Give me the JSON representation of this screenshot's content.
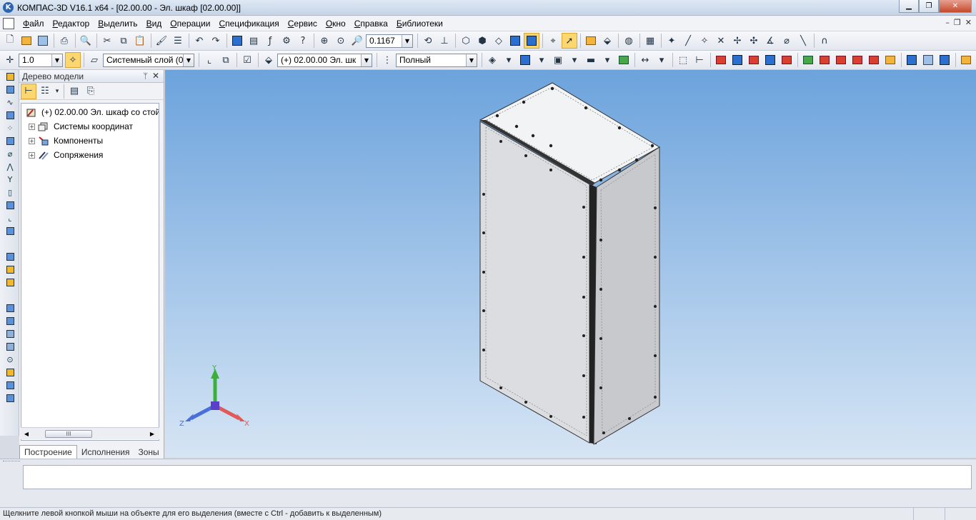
{
  "titlebar": {
    "title": "КОМПАС-3D V16.1 x64 - [02.00.00 - Эл. шкаф [02.00.00]]",
    "logo_letter": "K",
    "minimize": "▁",
    "maximize": "❐",
    "close": "✕"
  },
  "menu": [
    "Файл",
    "Редактор",
    "Выделить",
    "Вид",
    "Операции",
    "Спецификация",
    "Сервис",
    "Окно",
    "Справка",
    "Библиотеки"
  ],
  "mdi_controls": {
    "minimize": "–",
    "restore": "❐",
    "close": "✕"
  },
  "toolbar_top": {
    "zoom_value": "0.1167"
  },
  "toolbar_second": {
    "scale_value": "1.0",
    "layer_value": "Системный слой (0)",
    "object_value": "(+) 02.00.00 Эл. шк",
    "display_value": "Полный"
  },
  "tree": {
    "header": "Дерево модели",
    "pin": "ᛘ",
    "close": "✕",
    "root": "(+) 02.00.00 Эл. шкаф со стой",
    "children": [
      "Системы координат",
      "Компоненты",
      "Сопряжения"
    ],
    "scroll_thumb": "III",
    "tabs": [
      "Построение",
      "Исполнения",
      "Зоны"
    ]
  },
  "triad": {
    "y": "Y",
    "x": "X",
    "z": "Z"
  },
  "colors": {
    "viewport_top": "#6ca3dc",
    "viewport_bottom": "#d6e4f3",
    "highlight": "#fcd770",
    "axis_x": "#e05a5a",
    "axis_y": "#3ab03a",
    "axis_z": "#4a6fd8"
  },
  "icons": {
    "left_toolbar": [
      "sketch-icon",
      "extrude-icon",
      "rotate-icon",
      "kinematic-icon",
      "array-icon",
      "mirror-icon",
      "shell-icon",
      "rib-icon",
      "chamfer-icon",
      "fillet-icon",
      "hole-icon",
      "plane-icon",
      "axis-icon",
      "surface-icon",
      "spec-icon",
      "measure-icon",
      "assembly-icon",
      "component-icon",
      "mate-icon",
      "move-icon",
      "rotate-component-icon",
      "section-icon",
      "filter-icon",
      "lock-icon",
      "library-icon",
      "insert-icon"
    ]
  },
  "status": {
    "message": "Щелкните левой кнопкой мыши на объекте для его выделения (вместе с Ctrl - добавить к выделенным)"
  }
}
